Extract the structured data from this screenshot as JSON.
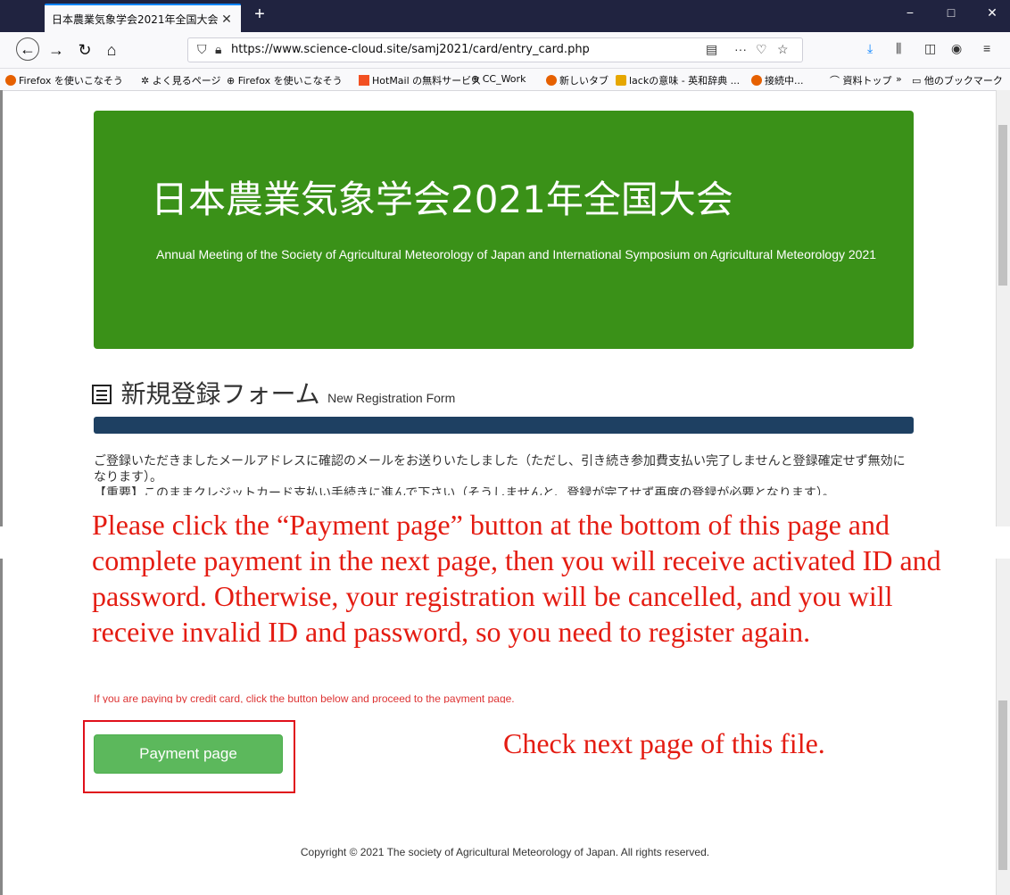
{
  "browser": {
    "tab_title": "日本農業気象学会2021年全国大会",
    "tab_close": "✕",
    "new_tab": "+",
    "url": "https://www.science-cloud.site/samj2021/card/entry_card.php",
    "window_controls": [
      "−",
      "□",
      "✕"
    ],
    "bookmarks": [
      "Firefox を使いこなそう",
      "よく見るページ",
      "Firefox を使いこなそう",
      "HotMail の無料サービス",
      "CC_Work",
      "新しいタブ",
      "lackの意味 - 英和辞典 ...",
      "接続中...",
      "資料トップ"
    ],
    "more_bookmarks": "»",
    "other_bookmarks": "他のブックマーク"
  },
  "hero": {
    "title": "日本農業気象学会2021年全国大会",
    "subtitle": "Annual Meeting of the Society of Agricultural Meteorology of Japan and International Symposium on Agricultural Meteorology 2021",
    "background": "#3a9118"
  },
  "form": {
    "title_jp": "新規登録フォーム",
    "title_en": "New Registration Form",
    "notice_jp": "ご登録いただきましたメールアドレスに確認のメールをお送りいたしました（ただし、引き続き参加費支払い完了しませんと登録確定せず無効になります）。",
    "notice_jp_cut": "【重要】このままクレジットカード支払い手続きに進んで下さい（そうしませんと、登録が完了せず再度の登録が必要となります）。",
    "cc_note": "If you are paying by credit card, click the button below and proceed to the payment page.",
    "payment_button": "Payment page"
  },
  "annotations": {
    "main": "Please click the “Payment page” button at the bottom of this page and complete payment in the next page, then you will receive activated ID and password. Otherwise, your registration will be cancelled, and you will receive invalid ID and password, so you need to register again.",
    "check": "Check next page of this file.",
    "color": "#e41c12"
  },
  "footer": {
    "copyright": "Copyright © 2021 The society of Agricultural Meteorology of Japan. All rights reserved."
  }
}
